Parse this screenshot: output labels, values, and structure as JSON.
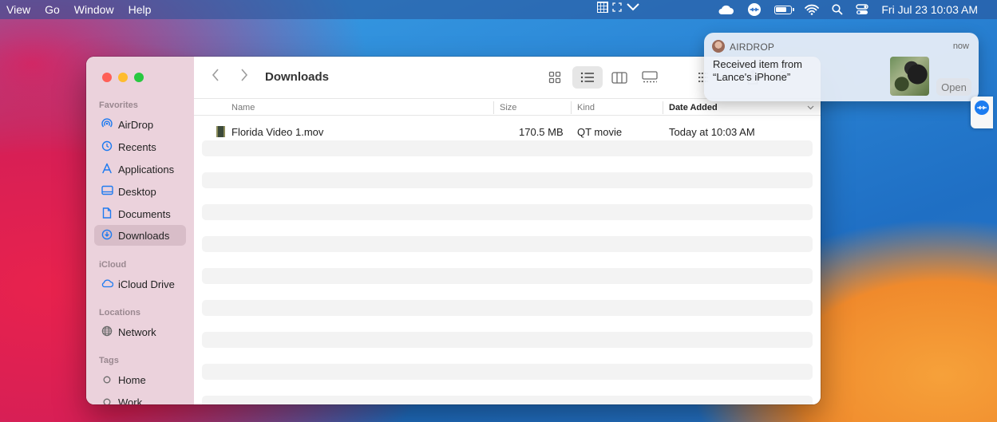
{
  "menubar": {
    "items": [
      "View",
      "Go",
      "Window",
      "Help"
    ],
    "clock": "Fri Jul 23  10:03 AM"
  },
  "finder": {
    "title": "Downloads",
    "sidebar": {
      "favorites_label": "Favorites",
      "favorites": [
        {
          "label": "AirDrop",
          "icon": "airdrop-icon"
        },
        {
          "label": "Recents",
          "icon": "clock-icon"
        },
        {
          "label": "Applications",
          "icon": "applications-icon"
        },
        {
          "label": "Desktop",
          "icon": "desktop-icon"
        },
        {
          "label": "Documents",
          "icon": "document-icon"
        },
        {
          "label": "Downloads",
          "icon": "download-icon",
          "selected": true
        }
      ],
      "icloud_label": "iCloud",
      "icloud": [
        {
          "label": "iCloud Drive",
          "icon": "cloud-icon"
        }
      ],
      "locations_label": "Locations",
      "locations": [
        {
          "label": "Network",
          "icon": "globe-icon"
        }
      ],
      "tags_label": "Tags",
      "tags": [
        {
          "label": "Home"
        },
        {
          "label": "Work"
        }
      ]
    },
    "columns": {
      "name": "Name",
      "size": "Size",
      "kind": "Kind",
      "date_added": "Date Added"
    },
    "files": [
      {
        "name": "Florida Video 1.mov",
        "size": "170.5 MB",
        "kind": "QT movie",
        "date_added": "Today at 10:03 AM"
      }
    ]
  },
  "notification": {
    "app": "AIRDROP",
    "time": "now",
    "line1": "Received item from",
    "line2": "“Lance's iPhone”",
    "action": "Open"
  },
  "colors": {
    "accent": "#1e7bf0",
    "sidebar_bg": "#ebd2dc"
  }
}
